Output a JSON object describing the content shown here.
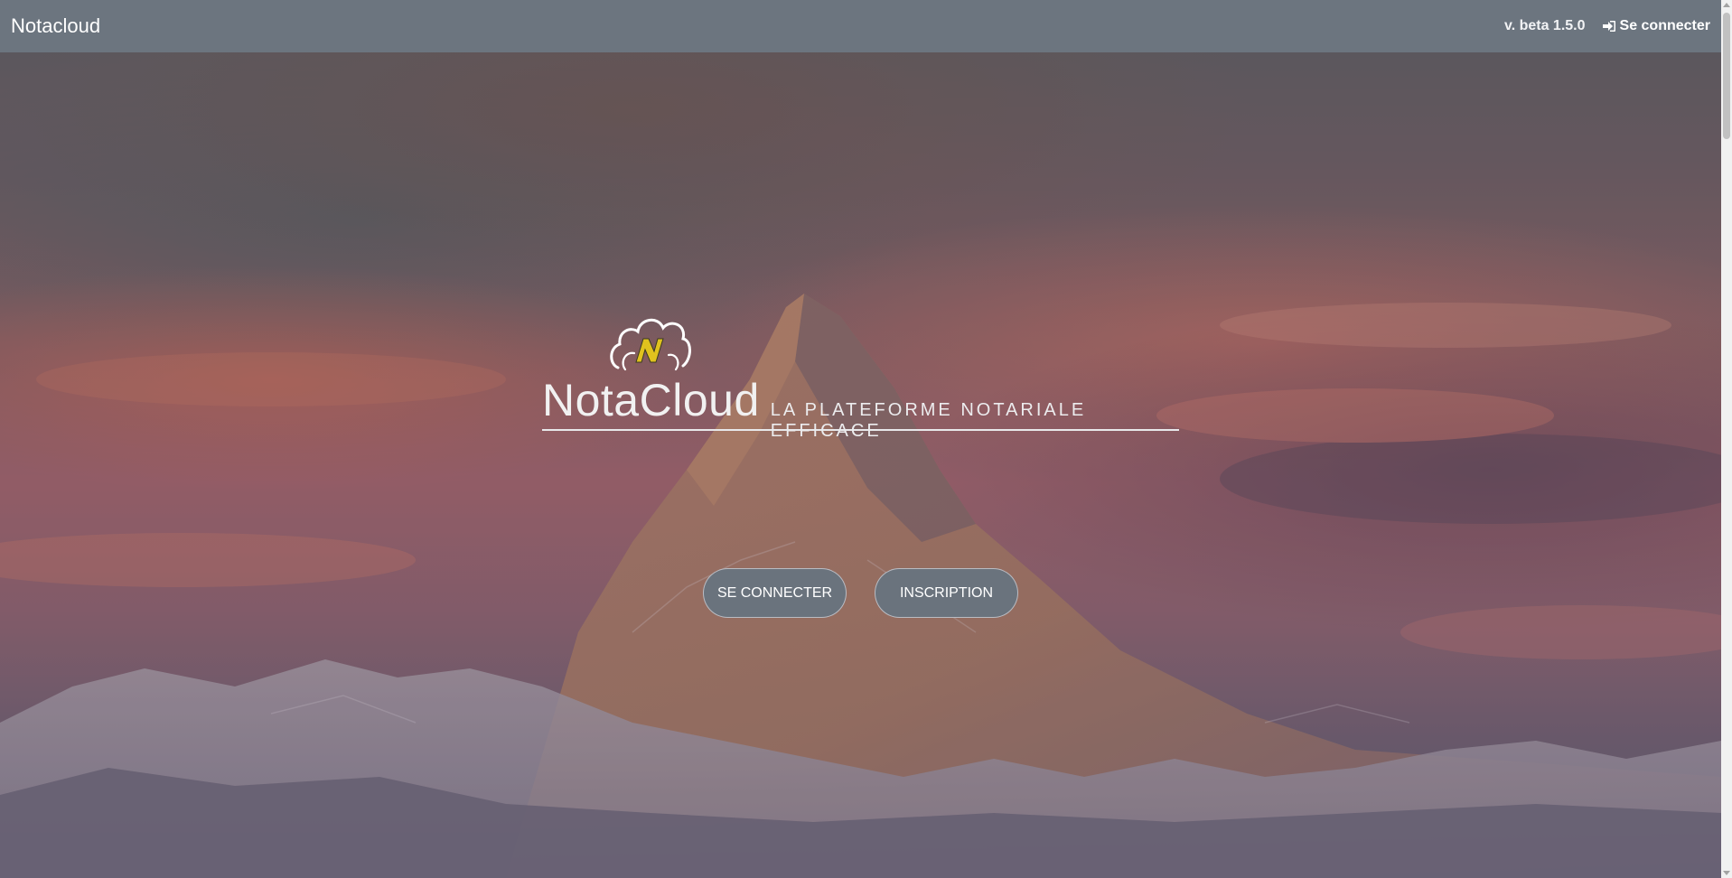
{
  "navbar": {
    "brand": "Notacloud",
    "version": "v. beta 1.5.0",
    "login_label": "Se connecter",
    "login_icon": "sign-in-icon",
    "background_color": "#6c757f"
  },
  "hero": {
    "logo_icon": "cloud-lightning-logo",
    "title": "NotaCloud",
    "tagline": "LA PLATEFORME NOTARIALE EFFICACE",
    "buttons": {
      "login_label": "SE CONNECTER",
      "signup_label": "INSCRIPTION"
    },
    "background_image": "mountain-peak-sunset"
  },
  "colors": {
    "button": "#6a737d",
    "logo_lightning": "#e0c21e",
    "logo_outline": "#ffffff"
  }
}
